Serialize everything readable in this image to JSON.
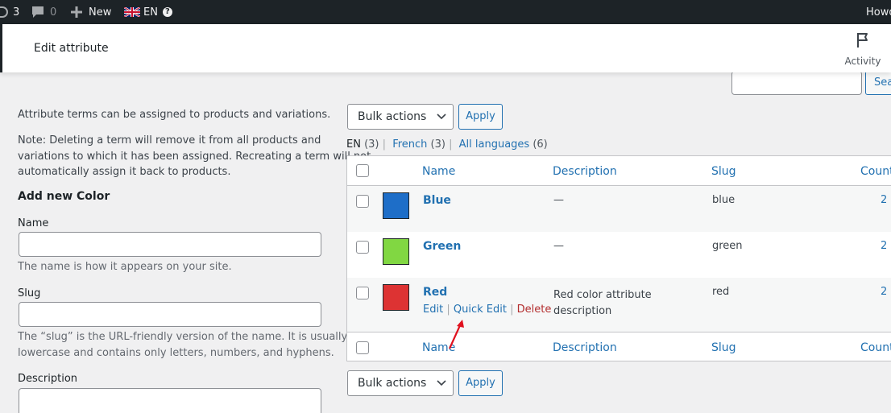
{
  "adminbar": {
    "updates_count": "3",
    "comments_count": "0",
    "new_label": "New",
    "language": "EN",
    "howdy_partial": "Howd"
  },
  "header": {
    "title": "Edit attribute",
    "activity_label": "Activity"
  },
  "search": {
    "button_label": "Sea"
  },
  "left": {
    "intro": "Attribute terms can be assigned to products and variations.",
    "note_line1": "Note: Deleting a term will remove it from all products and",
    "note_line2": "variations to which it has been assigned. Recreating a term will not",
    "note_line3": "automatically assign it back to products.",
    "add_title": "Add new Color",
    "name_label": "Name",
    "name_help": "The name is how it appears on your site.",
    "slug_label": "Slug",
    "slug_help_line1": "The “slug” is the URL-friendly version of the name. It is usually all",
    "slug_help_line2": "lowercase and contains only letters, numbers, and hyphens.",
    "description_label": "Description"
  },
  "bulk": {
    "top_select": "Bulk actions",
    "top_apply": "Apply",
    "bottom_select": "Bulk actions",
    "bottom_apply": "Apply"
  },
  "filters": {
    "en": "EN",
    "en_count": "(3)",
    "french": "French",
    "french_count": "(3)",
    "all": "All languages",
    "all_count": "(6)",
    "sep": "|"
  },
  "table": {
    "headers": {
      "name": "Name",
      "description": "Description",
      "slug": "Slug",
      "count": "Count"
    },
    "rows": [
      {
        "name": "Blue",
        "description": "—",
        "slug": "blue",
        "count": "2",
        "color": "#1e6ec8"
      },
      {
        "name": "Green",
        "description": "—",
        "slug": "green",
        "count": "2",
        "color": "#81d742"
      },
      {
        "name": "Red",
        "description_line1": "Red color attribute",
        "description_line2": "description",
        "slug": "red",
        "count": "2",
        "color": "#dd3333"
      }
    ],
    "row_actions": {
      "edit": "Edit",
      "quick_edit": "Quick Edit",
      "delete": "Delete",
      "sep": "|"
    }
  },
  "colors": {
    "link": "#2271b1",
    "delete": "#b32d2e",
    "arrow": "#e0111e"
  }
}
